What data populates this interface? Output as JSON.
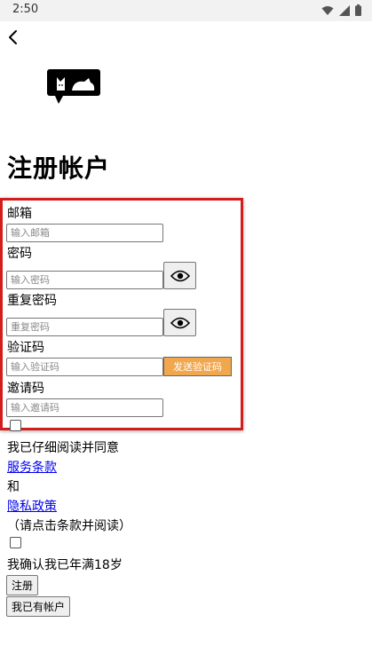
{
  "status_bar": {
    "time": "2:50"
  },
  "page": {
    "title": "注册帐户"
  },
  "form": {
    "email_label": "邮箱",
    "email_placeholder": "输入邮箱",
    "password_label": "密码",
    "password_placeholder": "输入密码",
    "repeat_password_label": "重复密码",
    "repeat_password_placeholder": "重复密码",
    "code_label": "验证码",
    "code_placeholder": "输入验证码",
    "send_code_label": "发送验证码",
    "invite_label": "邀请码",
    "invite_placeholder": "输入邀请码"
  },
  "agreement": {
    "text_read": "我已仔细阅读并同意",
    "terms_link": "服务条款",
    "and_text": "和",
    "privacy_link": "隐私政策",
    "hint": "（请点击条款并阅读）",
    "age_confirm": "我确认我已年满18岁"
  },
  "actions": {
    "register_label": "注册",
    "have_account_label": "我已有帐户"
  },
  "colors": {
    "highlight_border": "#d31d1d",
    "send_button_bg": "#f1a74e",
    "link": "#0000ee"
  },
  "icons": [
    "wifi-icon",
    "signal-icon",
    "battery-icon",
    "back-arrow-icon",
    "cat-logo-icon",
    "eye-icon"
  ]
}
